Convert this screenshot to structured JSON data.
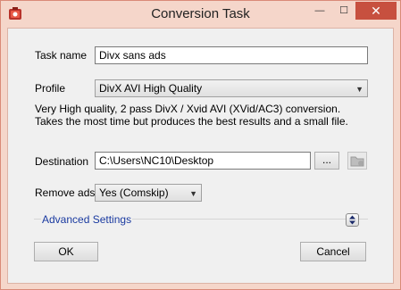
{
  "window": {
    "title": "Conversion Task",
    "minimize_glyph": "—",
    "maximize_glyph": "☐",
    "close_glyph": "✕"
  },
  "task_name": {
    "label": "Task name",
    "value": "Divx sans ads"
  },
  "profile": {
    "label": "Profile",
    "selected": "DivX AVI High Quality",
    "description": "Very High quality, 2 pass DivX / Xvid AVI (XVid/AC3) conversion. Takes the most time but produces the best results and a small file."
  },
  "destination": {
    "label": "Destination",
    "value": "C:\\Users\\NC10\\Desktop",
    "browse_label": "..."
  },
  "remove_ads": {
    "label": "Remove ads",
    "selected": "Yes (Comskip)"
  },
  "advanced": {
    "label": "Advanced Settings"
  },
  "buttons": {
    "ok": "OK",
    "cancel": "Cancel"
  },
  "icons": {
    "app": "app-icon",
    "folder": "folder-icon",
    "expand": "expand-collapse-icon"
  },
  "colors": {
    "frame": "#f5d6ca",
    "close": "#c7503f",
    "link": "#1a3aa0"
  }
}
